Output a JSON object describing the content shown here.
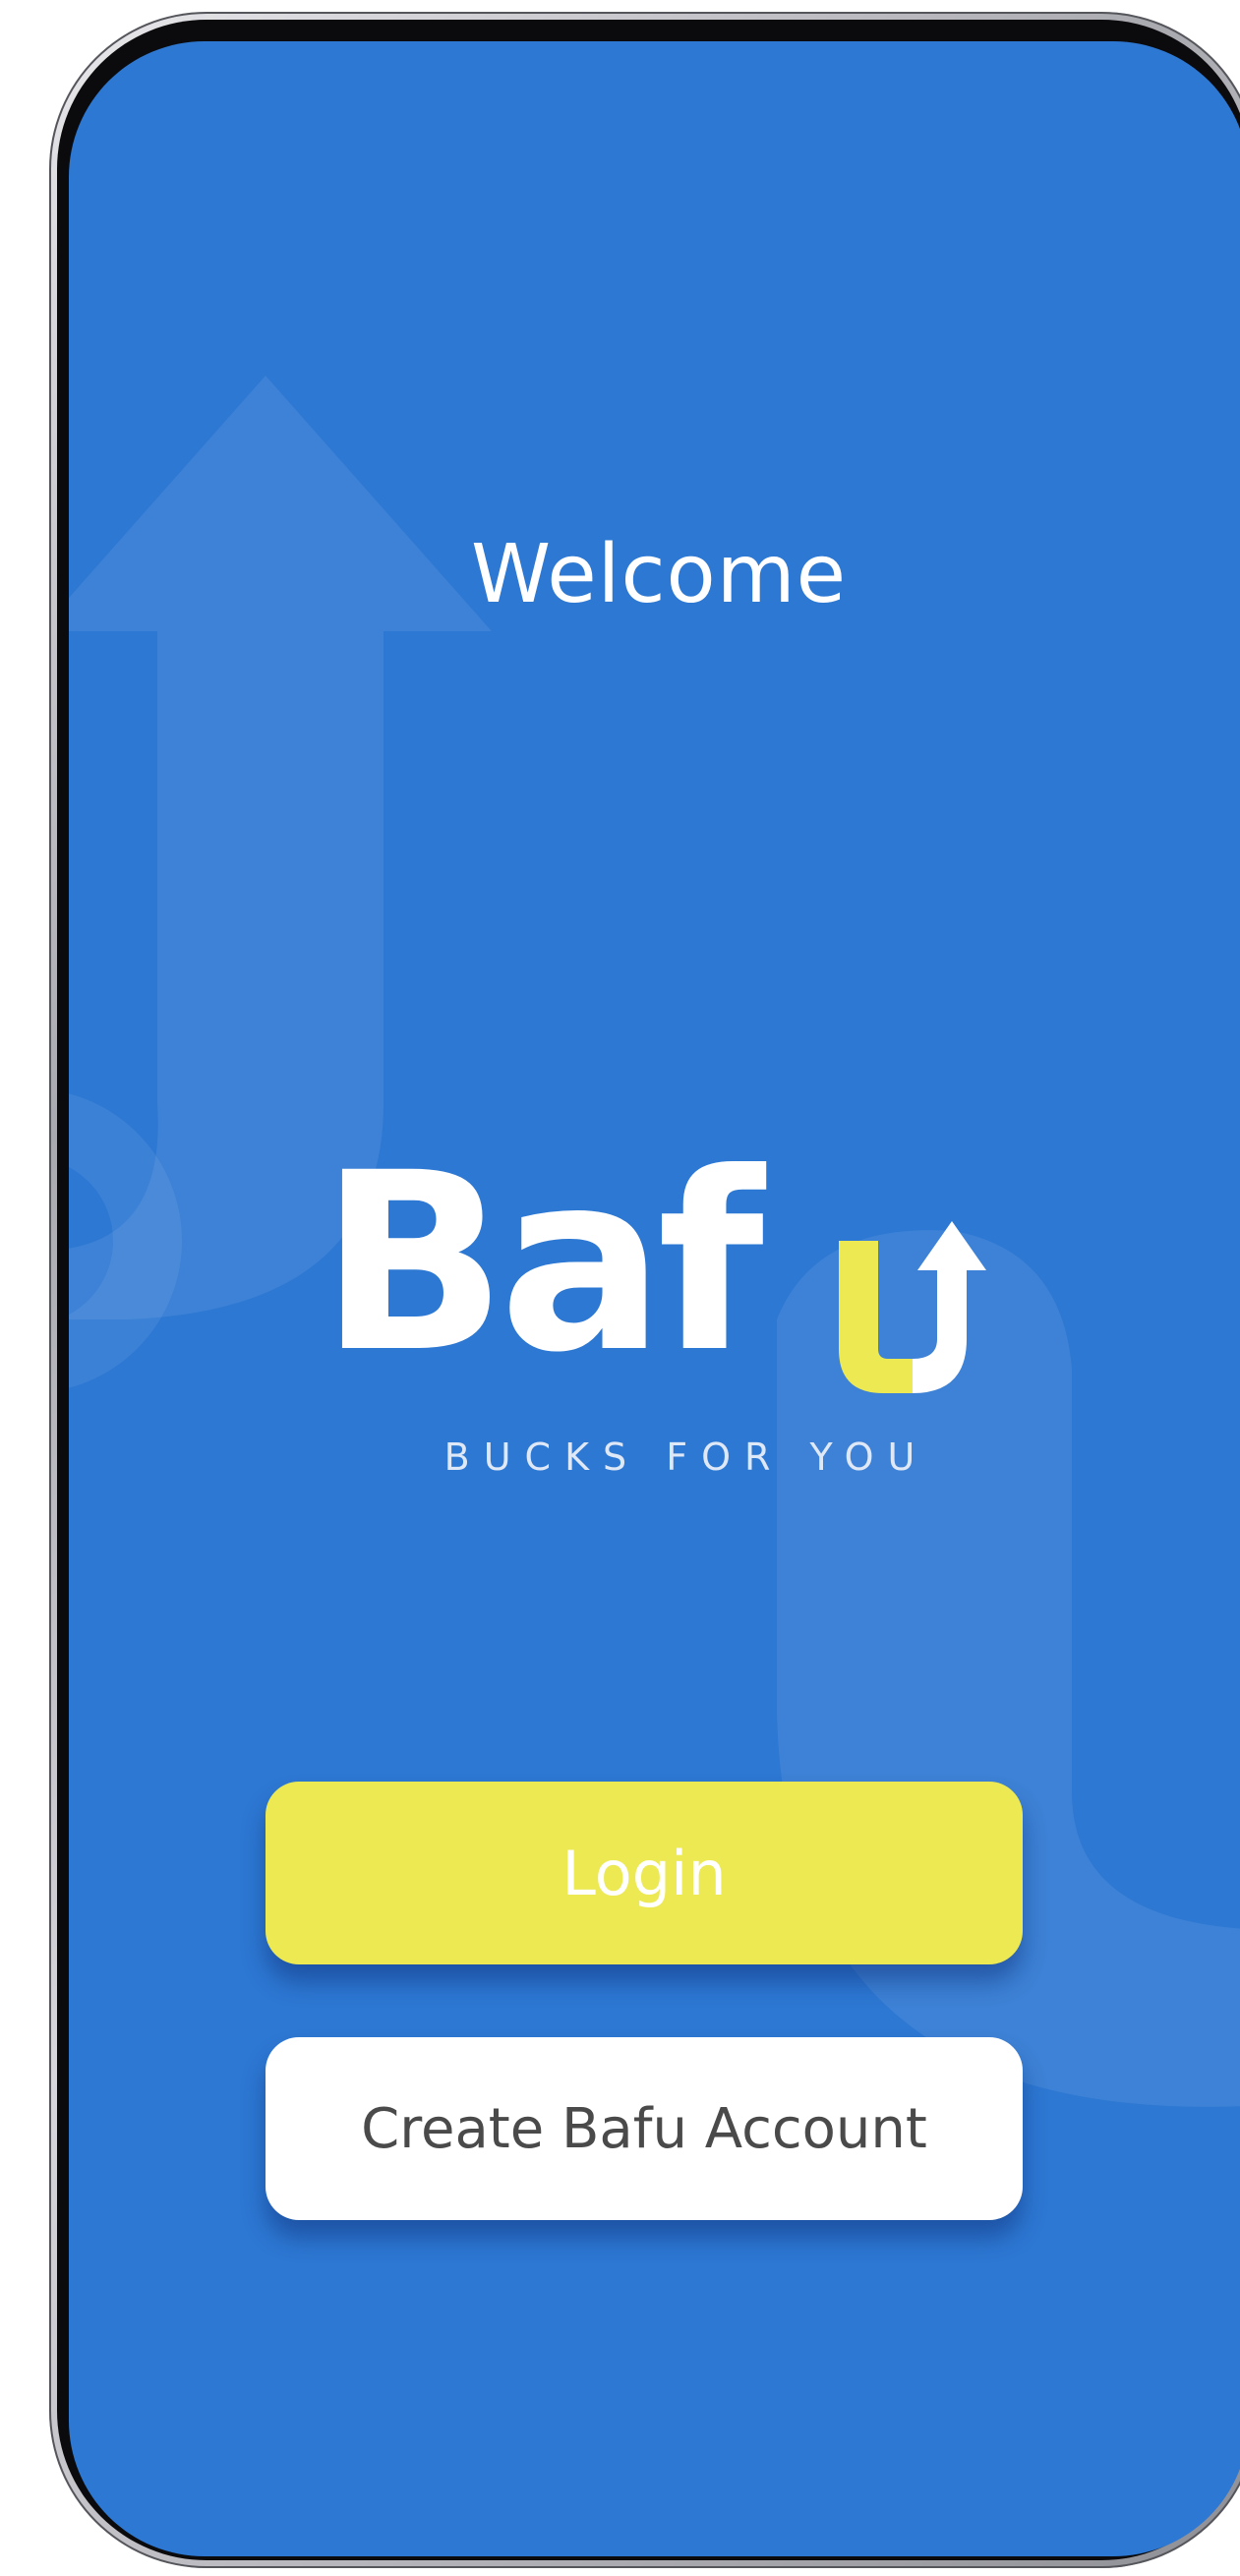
{
  "screen": {
    "welcome_text": "Welcome"
  },
  "logo": {
    "wordmark": "Baf",
    "wordmark_full": "Bafu",
    "tagline": "BUCKS FOR YOU",
    "accent_color": "#ece953"
  },
  "actions": {
    "login_label": "Login",
    "create_account_label": "Create Bafu Account"
  },
  "colors": {
    "background": "#2d78d3",
    "login_button": "#ece953",
    "create_button": "#ffffff"
  }
}
